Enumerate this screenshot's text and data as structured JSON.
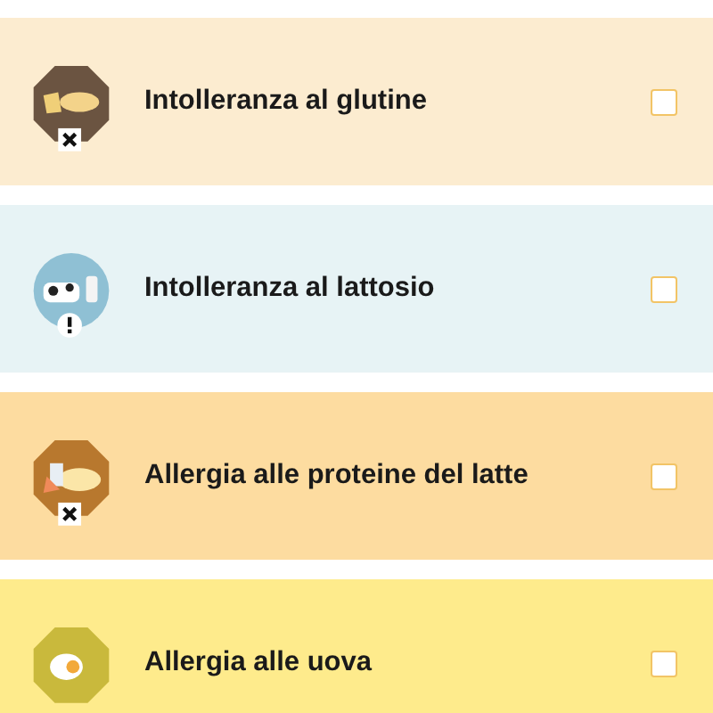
{
  "items": [
    {
      "label": "Intolleranza al glutine",
      "color": "#fcecd0",
      "icon": {
        "kind": "bread",
        "color": "#6b5441"
      },
      "badge": {
        "kind": "cross"
      },
      "checked": false
    },
    {
      "label": "Intolleranza al lattosio",
      "color": "#e7f3f5",
      "icon": {
        "kind": "cow",
        "color": "#8fc0d4"
      },
      "badge": {
        "kind": "exclamation"
      },
      "checked": false
    },
    {
      "label": "Allergia alle proteine del latte",
      "color": "#fddca0",
      "icon": {
        "kind": "cheese",
        "color": "#b8782e"
      },
      "badge": {
        "kind": "cross"
      },
      "checked": false
    },
    {
      "label": "Allergia alle uova",
      "color": "#feeb8c",
      "icon": {
        "kind": "egg",
        "color": "#c9b93c"
      },
      "checked": false
    }
  ]
}
